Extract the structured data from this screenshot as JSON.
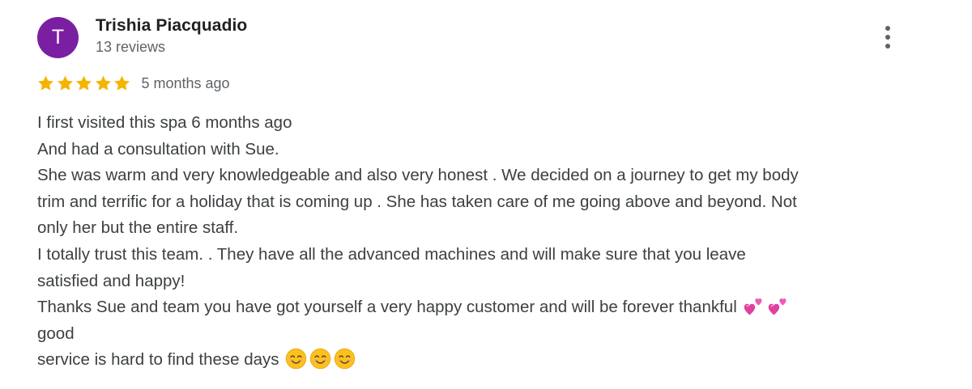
{
  "review": {
    "author": {
      "initial": "T",
      "name": "Trishia Piacquadio",
      "reviews_count": "13 reviews",
      "avatar_color": "#7b1fa2"
    },
    "rating": 5,
    "rating_max": 5,
    "star_color": "#f4b400",
    "date": "5 months ago",
    "menu_icon": "more-vert-icon",
    "text_lines": [
      "I first visited this spa 6 months ago",
      "And had a consultation with Sue.",
      "She was warm and very knowledgeable and also very honest . We decided on a journey to get my body",
      "trim and terrific for a holiday that is coming up . She has taken care of me going above and beyond. Not",
      "only her but the entire staff.",
      "I totally trust this team. . They have all the advanced machines and will make sure that you leave",
      "satisfied and happy!",
      "Thanks Sue and team you have got yourself a very happy customer and will be forever thankful",
      "good",
      "service is hard to find these days"
    ],
    "line_emojis": {
      "7": [
        "two-hearts-emoji",
        "two-hearts-emoji"
      ],
      "9": [
        "smiling-face-emoji",
        "smiling-face-emoji",
        "smiling-face-emoji"
      ]
    }
  }
}
